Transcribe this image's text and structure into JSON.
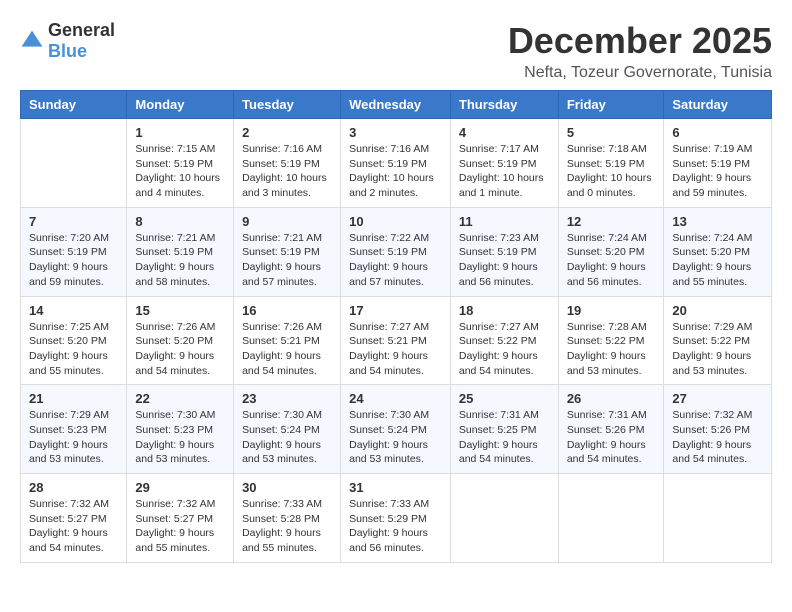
{
  "header": {
    "logo_general": "General",
    "logo_blue": "Blue",
    "month_title": "December 2025",
    "location": "Nefta, Tozeur Governorate, Tunisia"
  },
  "weekdays": [
    "Sunday",
    "Monday",
    "Tuesday",
    "Wednesday",
    "Thursday",
    "Friday",
    "Saturday"
  ],
  "weeks": [
    [
      {
        "day": "",
        "sunrise": "",
        "sunset": "",
        "daylight": ""
      },
      {
        "day": "1",
        "sunrise": "Sunrise: 7:15 AM",
        "sunset": "Sunset: 5:19 PM",
        "daylight": "Daylight: 10 hours and 4 minutes."
      },
      {
        "day": "2",
        "sunrise": "Sunrise: 7:16 AM",
        "sunset": "Sunset: 5:19 PM",
        "daylight": "Daylight: 10 hours and 3 minutes."
      },
      {
        "day": "3",
        "sunrise": "Sunrise: 7:16 AM",
        "sunset": "Sunset: 5:19 PM",
        "daylight": "Daylight: 10 hours and 2 minutes."
      },
      {
        "day": "4",
        "sunrise": "Sunrise: 7:17 AM",
        "sunset": "Sunset: 5:19 PM",
        "daylight": "Daylight: 10 hours and 1 minute."
      },
      {
        "day": "5",
        "sunrise": "Sunrise: 7:18 AM",
        "sunset": "Sunset: 5:19 PM",
        "daylight": "Daylight: 10 hours and 0 minutes."
      },
      {
        "day": "6",
        "sunrise": "Sunrise: 7:19 AM",
        "sunset": "Sunset: 5:19 PM",
        "daylight": "Daylight: 9 hours and 59 minutes."
      }
    ],
    [
      {
        "day": "7",
        "sunrise": "Sunrise: 7:20 AM",
        "sunset": "Sunset: 5:19 PM",
        "daylight": "Daylight: 9 hours and 59 minutes."
      },
      {
        "day": "8",
        "sunrise": "Sunrise: 7:21 AM",
        "sunset": "Sunset: 5:19 PM",
        "daylight": "Daylight: 9 hours and 58 minutes."
      },
      {
        "day": "9",
        "sunrise": "Sunrise: 7:21 AM",
        "sunset": "Sunset: 5:19 PM",
        "daylight": "Daylight: 9 hours and 57 minutes."
      },
      {
        "day": "10",
        "sunrise": "Sunrise: 7:22 AM",
        "sunset": "Sunset: 5:19 PM",
        "daylight": "Daylight: 9 hours and 57 minutes."
      },
      {
        "day": "11",
        "sunrise": "Sunrise: 7:23 AM",
        "sunset": "Sunset: 5:19 PM",
        "daylight": "Daylight: 9 hours and 56 minutes."
      },
      {
        "day": "12",
        "sunrise": "Sunrise: 7:24 AM",
        "sunset": "Sunset: 5:20 PM",
        "daylight": "Daylight: 9 hours and 56 minutes."
      },
      {
        "day": "13",
        "sunrise": "Sunrise: 7:24 AM",
        "sunset": "Sunset: 5:20 PM",
        "daylight": "Daylight: 9 hours and 55 minutes."
      }
    ],
    [
      {
        "day": "14",
        "sunrise": "Sunrise: 7:25 AM",
        "sunset": "Sunset: 5:20 PM",
        "daylight": "Daylight: 9 hours and 55 minutes."
      },
      {
        "day": "15",
        "sunrise": "Sunrise: 7:26 AM",
        "sunset": "Sunset: 5:20 PM",
        "daylight": "Daylight: 9 hours and 54 minutes."
      },
      {
        "day": "16",
        "sunrise": "Sunrise: 7:26 AM",
        "sunset": "Sunset: 5:21 PM",
        "daylight": "Daylight: 9 hours and 54 minutes."
      },
      {
        "day": "17",
        "sunrise": "Sunrise: 7:27 AM",
        "sunset": "Sunset: 5:21 PM",
        "daylight": "Daylight: 9 hours and 54 minutes."
      },
      {
        "day": "18",
        "sunrise": "Sunrise: 7:27 AM",
        "sunset": "Sunset: 5:22 PM",
        "daylight": "Daylight: 9 hours and 54 minutes."
      },
      {
        "day": "19",
        "sunrise": "Sunrise: 7:28 AM",
        "sunset": "Sunset: 5:22 PM",
        "daylight": "Daylight: 9 hours and 53 minutes."
      },
      {
        "day": "20",
        "sunrise": "Sunrise: 7:29 AM",
        "sunset": "Sunset: 5:22 PM",
        "daylight": "Daylight: 9 hours and 53 minutes."
      }
    ],
    [
      {
        "day": "21",
        "sunrise": "Sunrise: 7:29 AM",
        "sunset": "Sunset: 5:23 PM",
        "daylight": "Daylight: 9 hours and 53 minutes."
      },
      {
        "day": "22",
        "sunrise": "Sunrise: 7:30 AM",
        "sunset": "Sunset: 5:23 PM",
        "daylight": "Daylight: 9 hours and 53 minutes."
      },
      {
        "day": "23",
        "sunrise": "Sunrise: 7:30 AM",
        "sunset": "Sunset: 5:24 PM",
        "daylight": "Daylight: 9 hours and 53 minutes."
      },
      {
        "day": "24",
        "sunrise": "Sunrise: 7:30 AM",
        "sunset": "Sunset: 5:24 PM",
        "daylight": "Daylight: 9 hours and 53 minutes."
      },
      {
        "day": "25",
        "sunrise": "Sunrise: 7:31 AM",
        "sunset": "Sunset: 5:25 PM",
        "daylight": "Daylight: 9 hours and 54 minutes."
      },
      {
        "day": "26",
        "sunrise": "Sunrise: 7:31 AM",
        "sunset": "Sunset: 5:26 PM",
        "daylight": "Daylight: 9 hours and 54 minutes."
      },
      {
        "day": "27",
        "sunrise": "Sunrise: 7:32 AM",
        "sunset": "Sunset: 5:26 PM",
        "daylight": "Daylight: 9 hours and 54 minutes."
      }
    ],
    [
      {
        "day": "28",
        "sunrise": "Sunrise: 7:32 AM",
        "sunset": "Sunset: 5:27 PM",
        "daylight": "Daylight: 9 hours and 54 minutes."
      },
      {
        "day": "29",
        "sunrise": "Sunrise: 7:32 AM",
        "sunset": "Sunset: 5:27 PM",
        "daylight": "Daylight: 9 hours and 55 minutes."
      },
      {
        "day": "30",
        "sunrise": "Sunrise: 7:33 AM",
        "sunset": "Sunset: 5:28 PM",
        "daylight": "Daylight: 9 hours and 55 minutes."
      },
      {
        "day": "31",
        "sunrise": "Sunrise: 7:33 AM",
        "sunset": "Sunset: 5:29 PM",
        "daylight": "Daylight: 9 hours and 56 minutes."
      },
      {
        "day": "",
        "sunrise": "",
        "sunset": "",
        "daylight": ""
      },
      {
        "day": "",
        "sunrise": "",
        "sunset": "",
        "daylight": ""
      },
      {
        "day": "",
        "sunrise": "",
        "sunset": "",
        "daylight": ""
      }
    ]
  ]
}
